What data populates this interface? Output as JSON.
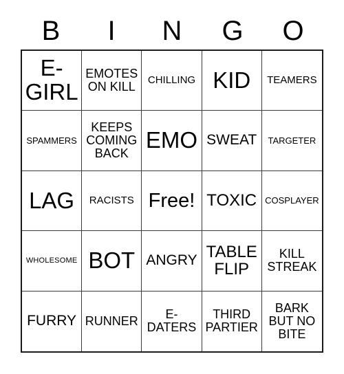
{
  "card": {
    "header_letters": [
      "B",
      "I",
      "N",
      "G",
      "O"
    ],
    "free_space_label": "Free!",
    "grid": [
      [
        {
          "label": "E-\nGIRL",
          "size": "fs-xxl"
        },
        {
          "label": "EMOTES\nON KILL",
          "size": "fs-sm"
        },
        {
          "label": "CHILLING",
          "size": "fs-xs"
        },
        {
          "label": "KID",
          "size": "fs-xxl"
        },
        {
          "label": "TEAMERS",
          "size": "fs-xs"
        }
      ],
      [
        {
          "label": "SPAMMERS",
          "size": "fs-xxs"
        },
        {
          "label": "KEEPS\nCOMING\nBACK",
          "size": "fs-sm"
        },
        {
          "label": "EMO",
          "size": "fs-xxl"
        },
        {
          "label": "SWEAT",
          "size": "fs-md"
        },
        {
          "label": "TARGETER",
          "size": "fs-xxs"
        }
      ],
      [
        {
          "label": "LAG",
          "size": "fs-xxl"
        },
        {
          "label": "RACISTS",
          "size": "fs-xs"
        },
        {
          "label": "Free!",
          "size": "fs-xl"
        },
        {
          "label": "TOXIC",
          "size": "fs-lg"
        },
        {
          "label": "COSPLAYER",
          "size": "fs-xxs"
        }
      ],
      [
        {
          "label": "WHOLESOME",
          "size": "fs-tiny"
        },
        {
          "label": "BOT",
          "size": "fs-xxl"
        },
        {
          "label": "ANGRY",
          "size": "fs-md"
        },
        {
          "label": "TABLE\nFLIP",
          "size": "fs-lg"
        },
        {
          "label": "KILL\nSTREAK",
          "size": "fs-sm"
        }
      ],
      [
        {
          "label": "FURRY",
          "size": "fs-md"
        },
        {
          "label": "RUNNER",
          "size": "fs-sm"
        },
        {
          "label": "E-\nDATERS",
          "size": "fs-sm"
        },
        {
          "label": "THIRD\nPARTIER",
          "size": "fs-sm"
        },
        {
          "label": "BARK\nBUT NO\nBITE",
          "size": "fs-sm"
        }
      ]
    ]
  },
  "colors": {
    "background": "#ffffff",
    "text": "#000000",
    "grid_line": "#3a3a3a",
    "grid_border": "#1a1a1a"
  }
}
